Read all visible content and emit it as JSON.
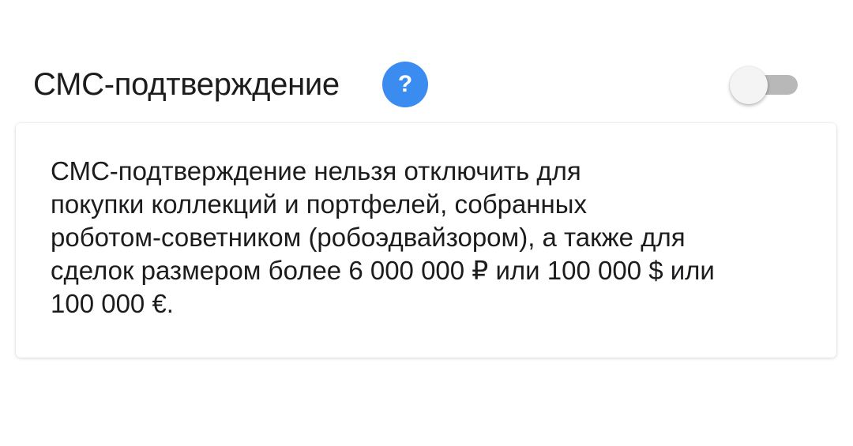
{
  "setting": {
    "title": "СМС-подтверждение",
    "help_label": "?",
    "toggle_state": "off"
  },
  "tooltip": {
    "text": "СМС-подтверждение нельзя отключить для\nпокупки коллекций и портфелей, собранных\nроботом-советником (робоэдвайзором), а также для\nсделок размером более 6 000 000 ₽ или 100 000 $ или\n100 000 €."
  },
  "colors": {
    "help_button": "#3b8cf0",
    "toggle_track": "#b8b8b8",
    "toggle_thumb": "#f4f4f4",
    "text": "#1c1c1e"
  }
}
